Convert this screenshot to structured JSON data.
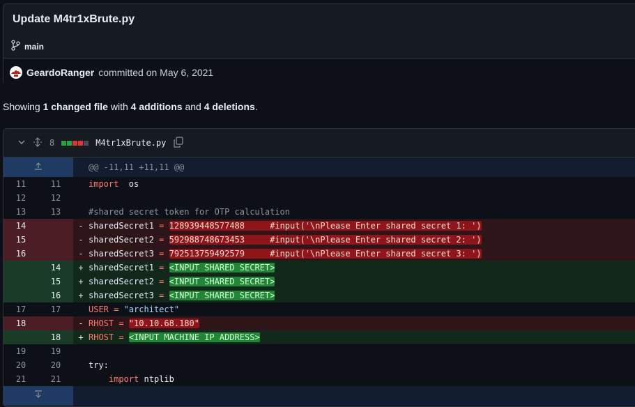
{
  "commit": {
    "title": "Update M4tr1xBrute.py",
    "branch": "main",
    "author": "GeardoRanger",
    "meta": "committed on May 6, 2021"
  },
  "summary": {
    "prefix": "Showing",
    "files": "1 changed file",
    "with": "with",
    "additions": "4 additions",
    "and": "and",
    "deletions": "4 deletions",
    "end": "."
  },
  "file": {
    "change_count": "8",
    "name": "M4tr1xBrute.py",
    "hunk": "@@ -11,11 +11,11 @@",
    "lines": [
      {
        "type": "ctx",
        "old": "11",
        "new": "11",
        "marker": "",
        "parts": [
          [
            "kw",
            "import"
          ],
          [
            "",
            "  os"
          ]
        ]
      },
      {
        "type": "ctx",
        "old": "12",
        "new": "12",
        "marker": "",
        "parts": []
      },
      {
        "type": "ctx",
        "old": "13",
        "new": "13",
        "marker": "",
        "parts": [
          [
            "cm",
            "#shared secret token for OTP calculation"
          ]
        ]
      },
      {
        "type": "del",
        "old": "14",
        "new": "",
        "marker": "-",
        "parts": [
          [
            "",
            "sharedSecret1 "
          ],
          [
            "kw",
            "="
          ],
          [
            "",
            ""
          ],
          [
            "hl-del",
            "128939448577488     #input('\\nPlease Enter shared secret 1: ')"
          ]
        ]
      },
      {
        "type": "del",
        "old": "15",
        "new": "",
        "marker": "-",
        "parts": [
          [
            "",
            "sharedSecret2 "
          ],
          [
            "kw",
            "="
          ],
          [
            "",
            ""
          ],
          [
            "hl-del",
            "592988748673453     #input('\\nPlease Enter shared secret 2: ')"
          ]
        ]
      },
      {
        "type": "del",
        "old": "16",
        "new": "",
        "marker": "-",
        "parts": [
          [
            "",
            "sharedSecret3 "
          ],
          [
            "kw",
            "="
          ],
          [
            "",
            ""
          ],
          [
            "hl-del",
            "792513759492579     #input('\\nPlease Enter shared secret 3: ')"
          ]
        ]
      },
      {
        "type": "add",
        "old": "",
        "new": "14",
        "marker": "+",
        "parts": [
          [
            "",
            "sharedSecret1 "
          ],
          [
            "kw",
            "="
          ],
          [
            "",
            ""
          ],
          [
            "hl-add",
            "<INPUT SHARED SECRET>"
          ]
        ]
      },
      {
        "type": "add",
        "old": "",
        "new": "15",
        "marker": "+",
        "parts": [
          [
            "",
            "sharedSecret2 "
          ],
          [
            "kw",
            "="
          ],
          [
            "",
            ""
          ],
          [
            "hl-add",
            "<INPUT SHARED SECRET>"
          ]
        ]
      },
      {
        "type": "add",
        "old": "",
        "new": "16",
        "marker": "+",
        "parts": [
          [
            "",
            "sharedSecret3 "
          ],
          [
            "kw",
            "="
          ],
          [
            "",
            ""
          ],
          [
            "hl-add",
            "<INPUT SHARED SECRET>"
          ]
        ]
      },
      {
        "type": "ctx",
        "old": "17",
        "new": "17",
        "marker": "",
        "parts": [
          [
            "kw",
            "USER"
          ],
          [
            "",
            " "
          ],
          [
            "kw",
            "="
          ],
          [
            "",
            " "
          ],
          [
            "str",
            "\"architect\""
          ]
        ]
      },
      {
        "type": "del",
        "old": "18",
        "new": "",
        "marker": "-",
        "parts": [
          [
            "kw",
            "RHOST"
          ],
          [
            "",
            " "
          ],
          [
            "kw",
            "="
          ],
          [
            "",
            ""
          ],
          [
            "hl-del",
            "\"10.10.68.180\""
          ]
        ]
      },
      {
        "type": "add",
        "old": "",
        "new": "18",
        "marker": "+",
        "parts": [
          [
            "kw",
            "RHOST"
          ],
          [
            "",
            " "
          ],
          [
            "kw",
            "="
          ],
          [
            "",
            ""
          ],
          [
            "hl-add",
            "<INPUT MACHINE IP ADDRESS>"
          ]
        ]
      },
      {
        "type": "ctx",
        "old": "19",
        "new": "19",
        "marker": "",
        "parts": []
      },
      {
        "type": "ctx",
        "old": "20",
        "new": "20",
        "marker": "",
        "parts": [
          [
            "",
            "try:"
          ]
        ]
      },
      {
        "type": "ctx",
        "old": "21",
        "new": "21",
        "marker": "",
        "parts": [
          [
            "",
            "    "
          ],
          [
            "kw",
            "import"
          ],
          [
            "",
            " ntplib"
          ]
        ]
      }
    ]
  },
  "colors": {
    "stat_add": "#2ea043",
    "stat_del": "#da3633",
    "stat_neutral": "#484f58"
  }
}
